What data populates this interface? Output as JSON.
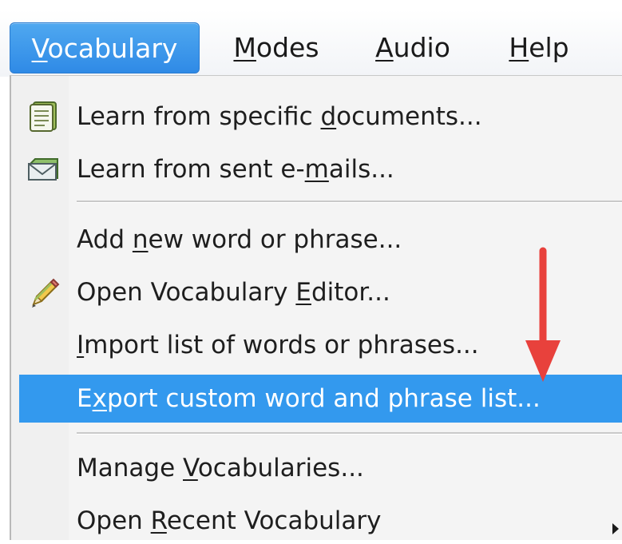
{
  "menubar": {
    "items": [
      {
        "pre": "",
        "key": "V",
        "post": "ocabulary",
        "active": true
      },
      {
        "pre": "",
        "key": "M",
        "post": "odes",
        "active": false
      },
      {
        "pre": "",
        "key": "A",
        "post": "udio",
        "active": false
      },
      {
        "pre": "",
        "key": "H",
        "post": "elp",
        "active": false
      }
    ]
  },
  "menu": {
    "items": [
      {
        "pre": "Learn from specific ",
        "key": "d",
        "post": "ocuments...",
        "icon": "document-icon"
      },
      {
        "pre": "Learn from sent e-",
        "key": "m",
        "post": "ails...",
        "icon": "email-icon"
      },
      {
        "pre": "Add ",
        "key": "n",
        "post": "ew word or phrase...",
        "icon": ""
      },
      {
        "pre": "Open Vocabulary ",
        "key": "E",
        "post": "ditor...",
        "icon": "pencil-icon"
      },
      {
        "pre": "",
        "key": "I",
        "post": "mport list of words or phrases...",
        "icon": ""
      },
      {
        "pre": "E",
        "key": "x",
        "post": "port custom word and phrase list...",
        "icon": "",
        "highlighted": true
      },
      {
        "pre": "Manage ",
        "key": "V",
        "post": "ocabularies...",
        "icon": ""
      },
      {
        "pre": "Open ",
        "key": "R",
        "post": "ecent Vocabulary",
        "icon": "",
        "submenu": true
      }
    ]
  },
  "colors": {
    "highlight": "#3399ee",
    "active_menubar": "#2f8ae6",
    "annotation_arrow": "#e8413c"
  }
}
